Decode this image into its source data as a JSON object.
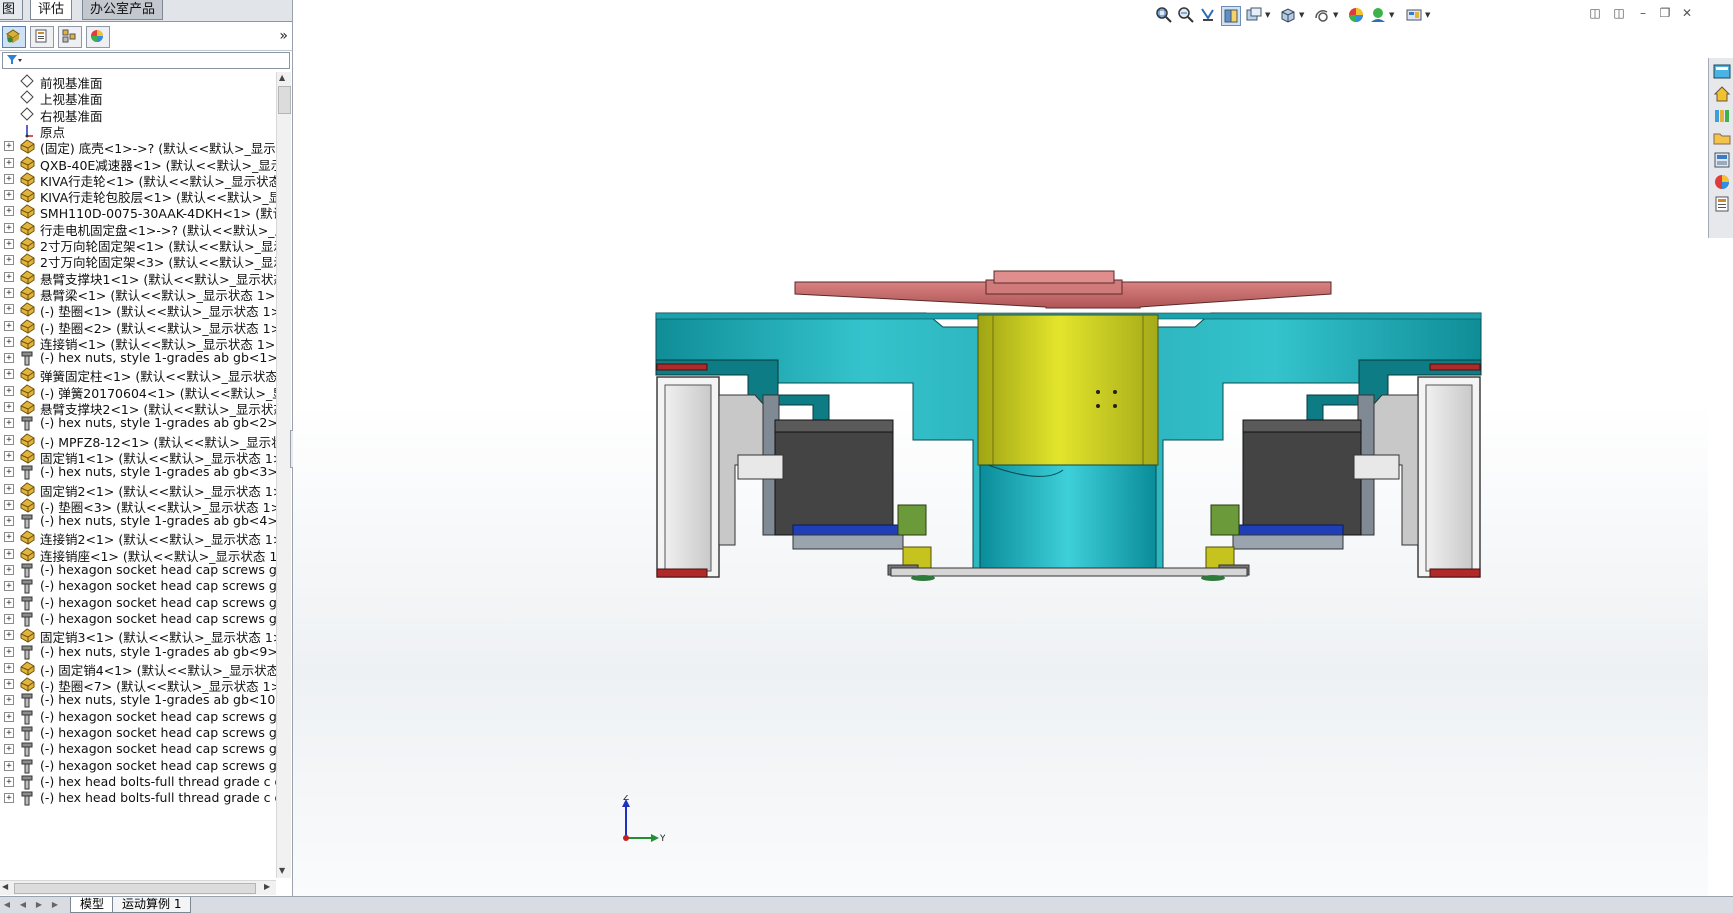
{
  "command_tabs": [
    {
      "label": "图"
    },
    {
      "label": "评估"
    },
    {
      "label": "办公室产品"
    }
  ],
  "feature_tree": {
    "items": [
      {
        "label": "前视基准面",
        "type": "plane",
        "expandable": false
      },
      {
        "label": "上视基准面",
        "type": "plane",
        "expandable": false
      },
      {
        "label": "右视基准面",
        "type": "plane",
        "expandable": false
      },
      {
        "label": "原点",
        "type": "origin",
        "expandable": false
      },
      {
        "label": "(固定) 底壳<1>->? (默认<<默认>_显示状态",
        "type": "part",
        "expandable": true
      },
      {
        "label": "QXB-40E减速器<1> (默认<<默认>_显示状",
        "type": "part",
        "expandable": true
      },
      {
        "label": "KIVA行走轮<1> (默认<<默认>_显示状态 1",
        "type": "part",
        "expandable": true
      },
      {
        "label": "KIVA行走轮包胶层<1> (默认<<默认>_显示",
        "type": "part",
        "expandable": true
      },
      {
        "label": "SMH110D-0075-30AAK-4DKH<1> (默认<",
        "type": "part",
        "expandable": true
      },
      {
        "label": "行走电机固定盘<1>->? (默认<<默认>_显示",
        "type": "part",
        "expandable": true
      },
      {
        "label": "2寸万向轮固定架<1> (默认<<默认>_显示状",
        "type": "part",
        "expandable": true
      },
      {
        "label": "2寸万向轮固定架<3> (默认<<默认>_显示状",
        "type": "part",
        "expandable": true
      },
      {
        "label": "悬臂支撑块1<1> (默认<<默认>_显示状态 1",
        "type": "part",
        "expandable": true
      },
      {
        "label": "悬臂梁<1> (默认<<默认>_显示状态 1>)",
        "type": "part",
        "expandable": true
      },
      {
        "label": "(-) 垫圈<1> (默认<<默认>_显示状态 1>)",
        "type": "part",
        "expandable": true
      },
      {
        "label": "(-) 垫圈<2> (默认<<默认>_显示状态 1>)",
        "type": "part",
        "expandable": true
      },
      {
        "label": "连接销<1> (默认<<默认>_显示状态 1>)",
        "type": "part",
        "expandable": true
      },
      {
        "label": "(-) hex nuts, style 1-grades ab gb<1> (G",
        "type": "toolbox",
        "expandable": true
      },
      {
        "label": "弹簧固定柱<1> (默认<<默认>_显示状态 1:",
        "type": "part",
        "expandable": true
      },
      {
        "label": "(-) 弹簧20170604<1> (默认<<默认>_显示",
        "type": "part",
        "expandable": true
      },
      {
        "label": "悬臂支撑块2<1> (默认<<默认>_显示状态 1",
        "type": "part",
        "expandable": true
      },
      {
        "label": "(-) hex nuts, style 1-grades ab gb<2> (G",
        "type": "toolbox",
        "expandable": true
      },
      {
        "label": "(-) MPFZ8-12<1> (默认<<默认>_显示状态",
        "type": "part",
        "expandable": true
      },
      {
        "label": "固定销1<1> (默认<<默认>_显示状态 1>)",
        "type": "part",
        "expandable": true
      },
      {
        "label": "(-) hex nuts, style 1-grades ab gb<3> (G",
        "type": "toolbox",
        "expandable": true
      },
      {
        "label": "固定销2<1> (默认<<默认>_显示状态 1>)",
        "type": "part",
        "expandable": true
      },
      {
        "label": "(-) 垫圈<3> (默认<<默认>_显示状态 1>)",
        "type": "part",
        "expandable": true
      },
      {
        "label": "(-) hex nuts, style 1-grades ab gb<4> (G",
        "type": "toolbox",
        "expandable": true
      },
      {
        "label": "连接销2<1> (默认<<默认>_显示状态 1>)",
        "type": "part",
        "expandable": true
      },
      {
        "label": "连接销座<1> (默认<<默认>_显示状态 1>)",
        "type": "part",
        "expandable": true
      },
      {
        "label": "(-) hexagon socket head cap screws gb<",
        "type": "toolbox",
        "expandable": true
      },
      {
        "label": "(-) hexagon socket head cap screws gb<",
        "type": "toolbox",
        "expandable": true
      },
      {
        "label": "(-) hexagon socket head cap screws gb<",
        "type": "toolbox",
        "expandable": true
      },
      {
        "label": "(-) hexagon socket head cap screws gb<",
        "type": "toolbox",
        "expandable": true
      },
      {
        "label": "固定销3<1> (默认<<默认>_显示状态 1>)",
        "type": "part",
        "expandable": true
      },
      {
        "label": "(-) hex nuts, style 1-grades ab gb<9> (G",
        "type": "toolbox",
        "expandable": true
      },
      {
        "label": "(-) 固定销4<1> (默认<<默认>_显示状态 1:",
        "type": "part",
        "expandable": true
      },
      {
        "label": "(-) 垫圈<7> (默认<<默认>_显示状态 1>)",
        "type": "part",
        "expandable": true
      },
      {
        "label": "(-) hex nuts, style 1-grades ab gb<10> (",
        "type": "toolbox",
        "expandable": true
      },
      {
        "label": "(-) hexagon socket head cap screws gb<",
        "type": "toolbox",
        "expandable": true
      },
      {
        "label": "(-) hexagon socket head cap screws gb<",
        "type": "toolbox",
        "expandable": true
      },
      {
        "label": "(-) hexagon socket head cap screws gb<",
        "type": "toolbox",
        "expandable": true
      },
      {
        "label": "(-) hexagon socket head cap screws gb<",
        "type": "toolbox",
        "expandable": true
      },
      {
        "label": "(-) hex head bolts-full thread grade c gb",
        "type": "toolbox",
        "expandable": true
      },
      {
        "label": "(-) hex head bolts-full thread grade c gb",
        "type": "toolbox",
        "expandable": true
      }
    ]
  },
  "bottom_tabs": [
    {
      "label": "模型"
    },
    {
      "label": "运动算例 1"
    }
  ],
  "triad": {
    "z_label": "Z",
    "y_label": "Y"
  },
  "colors": {
    "cyan_body": "#2ab3c0",
    "cyan_light": "#54d0d8",
    "teal_dark": "#0f7f86",
    "yellow_motor": "#c7c81e",
    "red_plate": "#c46565",
    "wheel_grey": "#d6d6d6",
    "gear_dark": "#3f3f3f",
    "tire_red": "#b02a2a",
    "selection_blue": "#cfe1f5"
  }
}
